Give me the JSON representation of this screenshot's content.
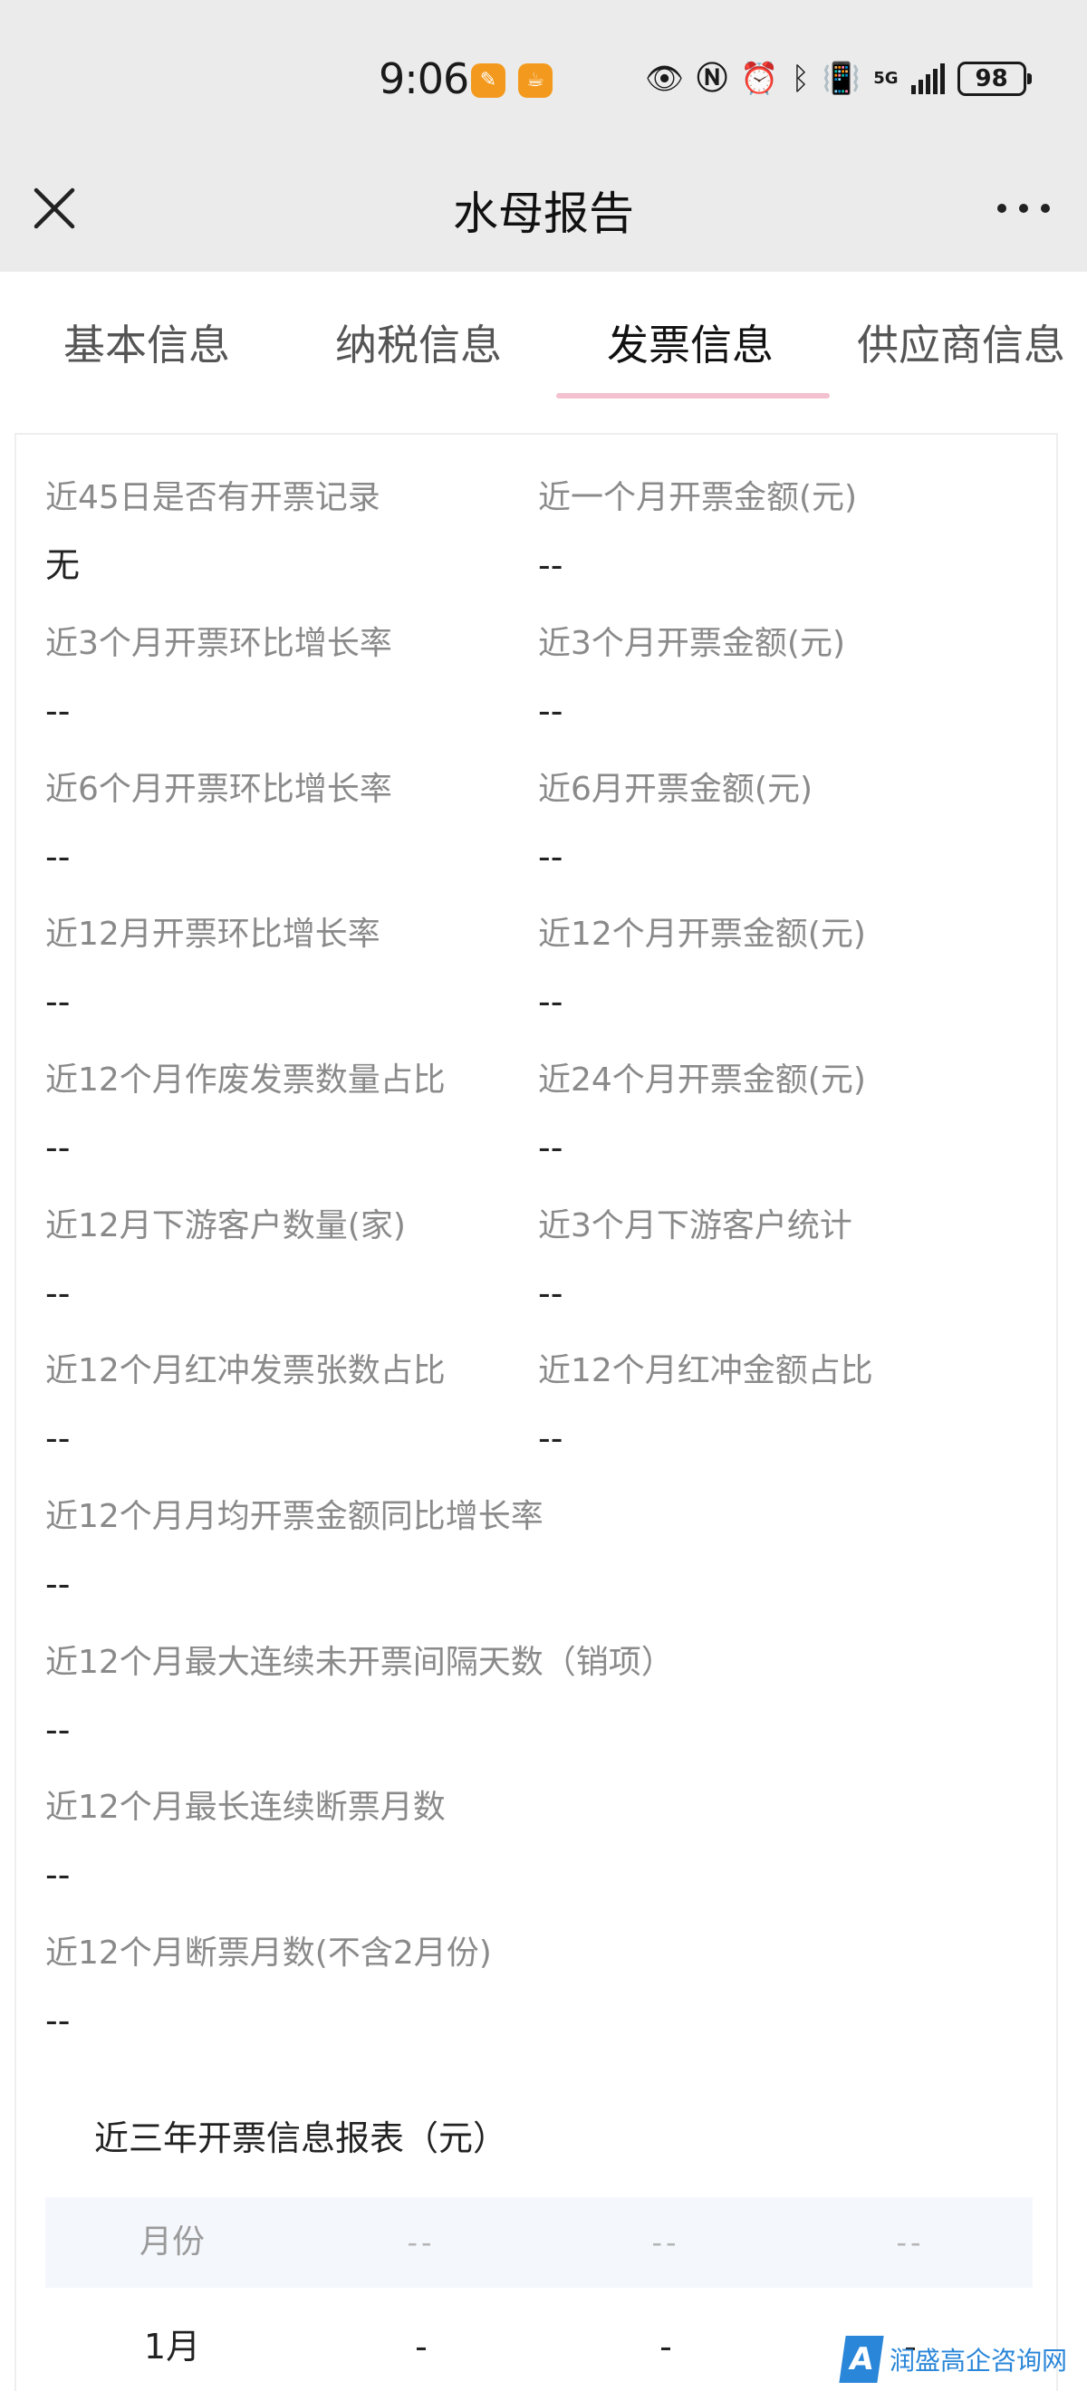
{
  "status_bar": {
    "time": "9:06",
    "app_icons": [
      "notes-app-icon",
      "cup-app-icon"
    ],
    "network": "5G",
    "battery": "98"
  },
  "nav": {
    "title": "水母报告",
    "close_icon": "close-icon",
    "more_icon": "more-icon"
  },
  "tabs": [
    {
      "label": "基本信息",
      "active": false
    },
    {
      "label": "纳税信息",
      "active": false
    },
    {
      "label": "发票信息",
      "active": true
    },
    {
      "label": "供应商信息",
      "active": false
    }
  ],
  "fields": [
    {
      "label": "近45日是否有开票记录",
      "value": "无"
    },
    {
      "label": "近一个月开票金额(元)",
      "value": "--"
    },
    {
      "label": "近3个月开票环比增长率",
      "value": "--"
    },
    {
      "label": "近3个月开票金额(元)",
      "value": "--"
    },
    {
      "label": "近6个月开票环比增长率",
      "value": "--"
    },
    {
      "label": "近6月开票金额(元)",
      "value": "--"
    },
    {
      "label": "近12月开票环比增长率",
      "value": "--"
    },
    {
      "label": "近12个月开票金额(元)",
      "value": "--"
    },
    {
      "label": "近12个月作废发票数量占比",
      "value": "--"
    },
    {
      "label": "近24个月开票金额(元)",
      "value": "--"
    },
    {
      "label": "近12月下游客户数量(家)",
      "value": "--"
    },
    {
      "label": "近3个月下游客户统计",
      "value": "--"
    },
    {
      "label": "近12个月红冲发票张数占比",
      "value": "--"
    },
    {
      "label": "近12个月红冲金额占比",
      "value": "--"
    },
    {
      "label": "近12个月月均开票金额同比增长率",
      "value": "--"
    },
    {
      "label": "近12个月最大连续未开票间隔天数（销项）",
      "value": "--"
    },
    {
      "label": "近12个月最长连续断票月数",
      "value": "--"
    },
    {
      "label": "近12个月断票月数(不含2月份)",
      "value": "--"
    }
  ],
  "report": {
    "title": "近三年开票信息报表（元）",
    "headers": [
      "月份",
      "--",
      "--",
      "--"
    ],
    "rows": [
      [
        "1月",
        "-",
        "-",
        "-"
      ]
    ]
  },
  "watermark": {
    "logo": "A",
    "text": "润盛高企咨询网"
  },
  "colors": {
    "header_bg": "#ebebeb",
    "tab_underline": "#f3c1cf",
    "table_header_bg": "#f4f7fc",
    "watermark_blue": "#2a86d8"
  }
}
